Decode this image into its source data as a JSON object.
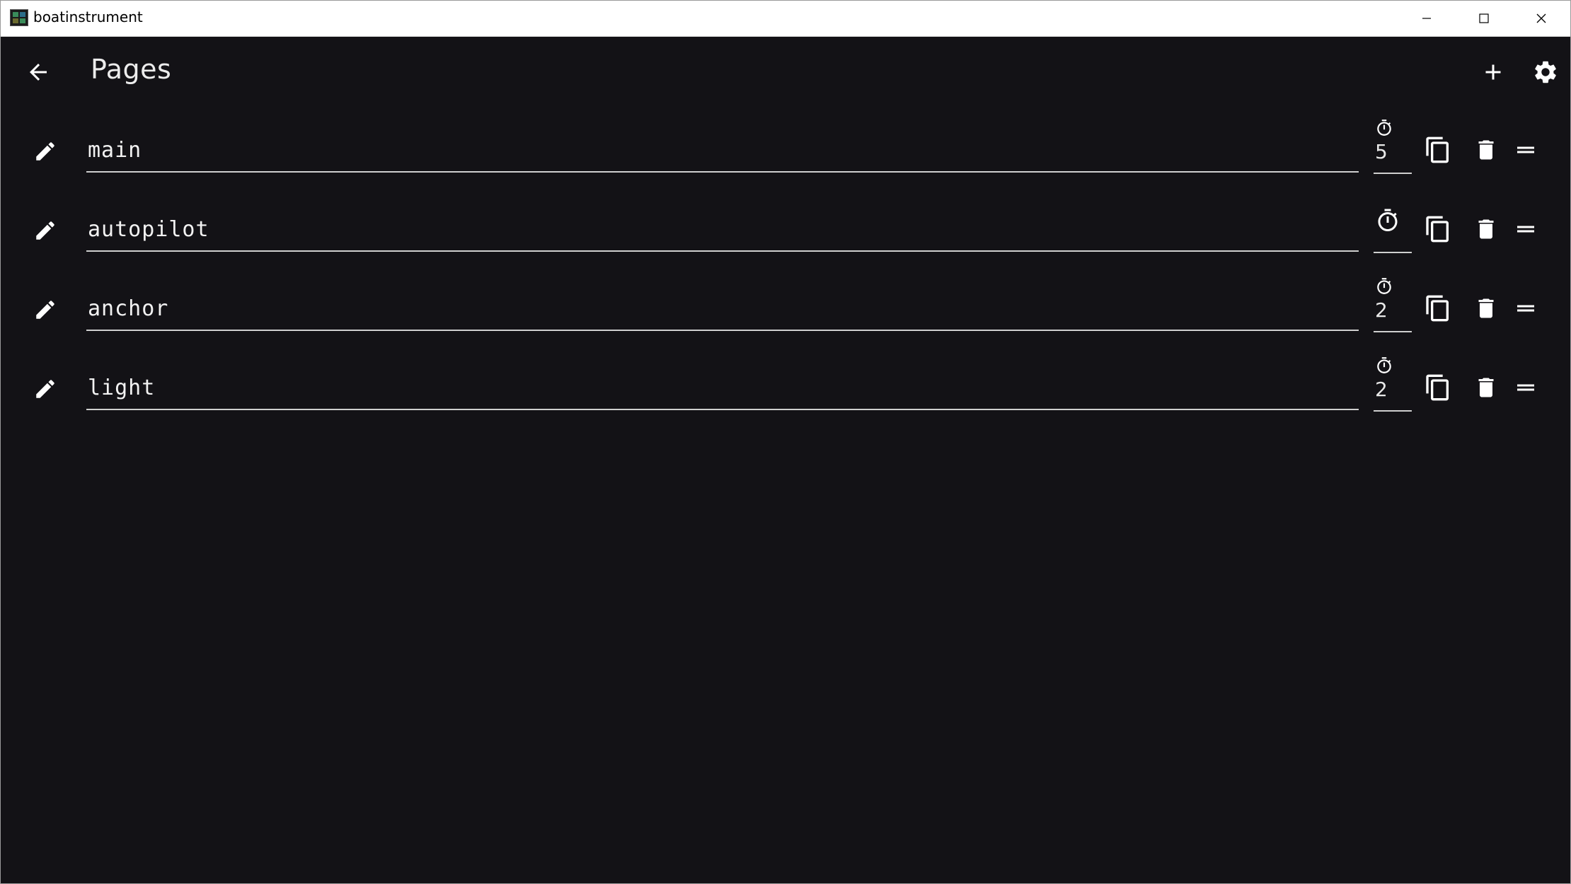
{
  "window": {
    "title": "boatinstrument"
  },
  "appbar": {
    "title": "Pages",
    "icons": [
      "arrow-back-icon",
      "add-icon",
      "settings-icon"
    ]
  },
  "pages": [
    {
      "name": "main",
      "timer": "5"
    },
    {
      "name": "autopilot",
      "timer": ""
    },
    {
      "name": "anchor",
      "timer": "2"
    },
    {
      "name": "light",
      "timer": "2"
    }
  ],
  "row_icons": [
    "edit-icon",
    "timer-icon",
    "copy-icon",
    "delete-icon",
    "drag-handle-icon"
  ],
  "colors": {
    "background": "#131216",
    "foreground": "#ffffff",
    "underline": "#cfcfcf"
  }
}
